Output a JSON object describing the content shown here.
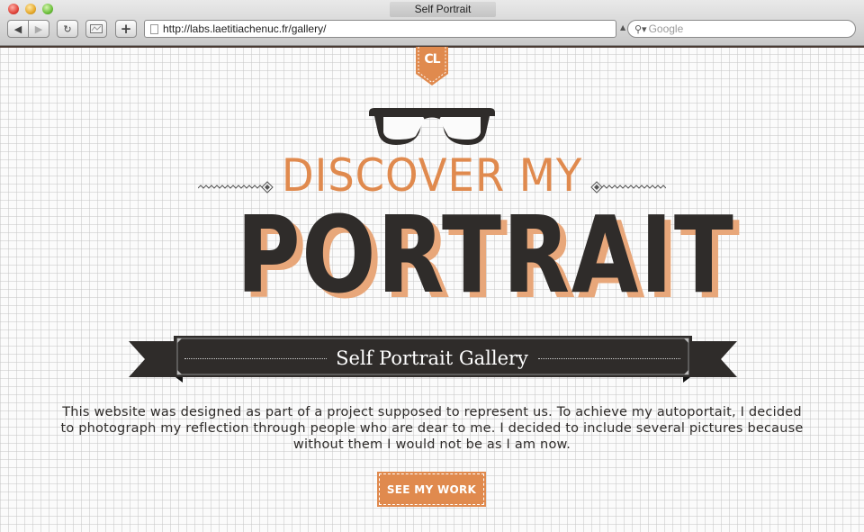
{
  "browser": {
    "window_title": "Self Portrait",
    "url": "http://labs.laetitiachenuc.fr/gallery/",
    "search_placeholder": "Google",
    "buttons": {
      "back": "◀",
      "forward": "▶",
      "reload": "↻",
      "add_tab": "+"
    },
    "icons": {
      "search": "🔍"
    }
  },
  "page": {
    "logo_text": "CL",
    "heading_top": "DISCOVER MY",
    "heading_main": "PORTRAIT",
    "ribbon_label": "Self Portrait Gallery",
    "description": "This website was designed as part of a project supposed to represent us. To achieve my autoportait, I decided to photograph my reflection through people who are dear to me. I decided to include several pictures because without them I would not be as I am now.",
    "cta_label": "SEE MY WORK",
    "colors": {
      "accent": "#e08a4e",
      "dark": "#2f2c2a"
    }
  }
}
